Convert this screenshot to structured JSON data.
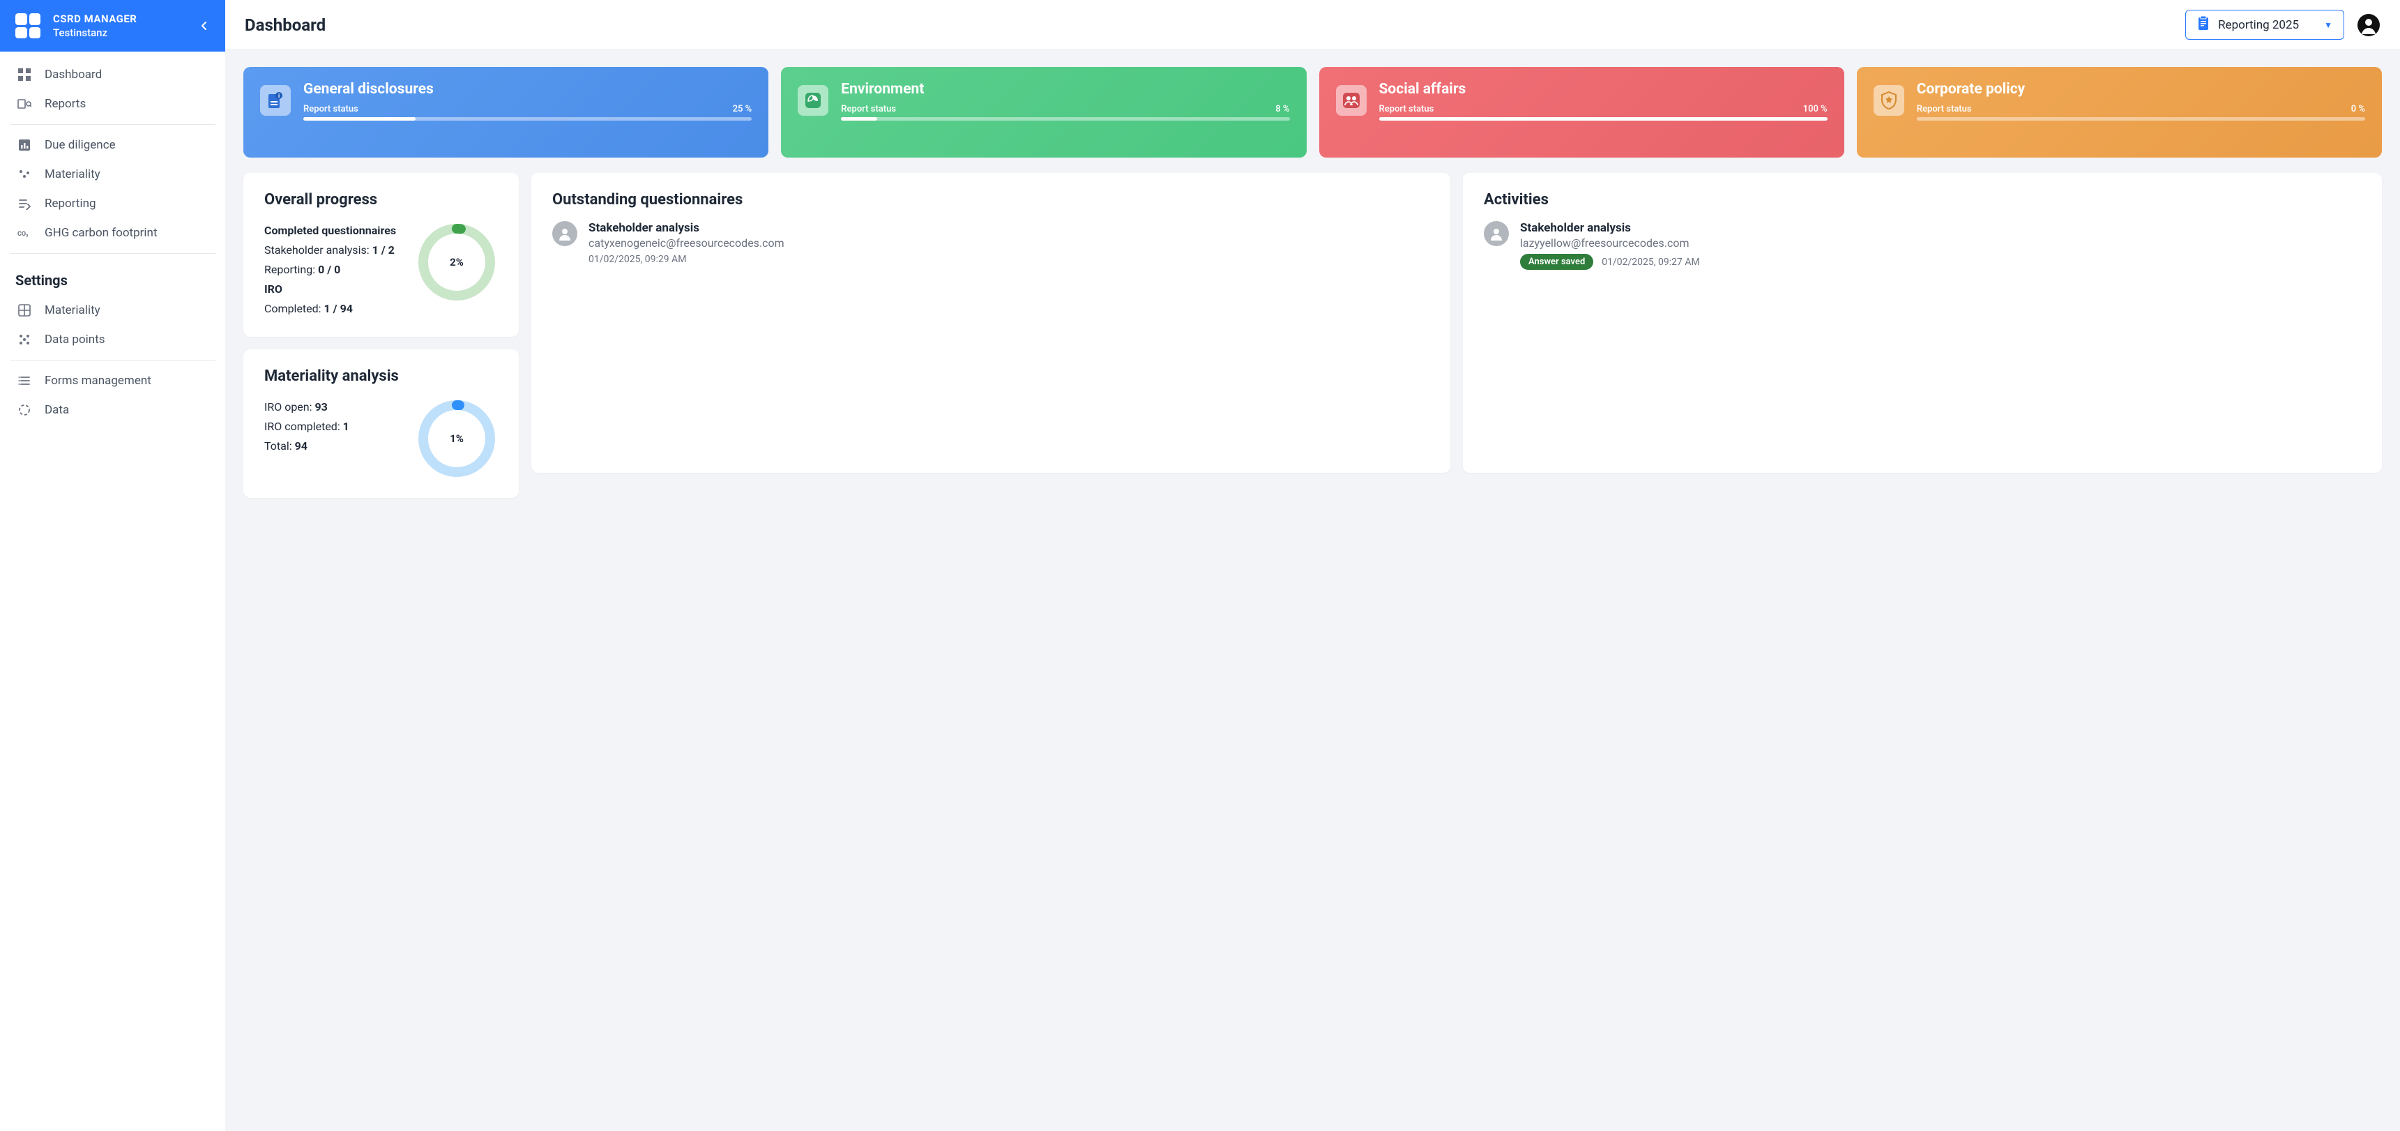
{
  "app": {
    "title": "CSRD MANAGER",
    "subtitle": "Testinstanz"
  },
  "sidebar": {
    "nav1": [
      {
        "label": "Dashboard"
      },
      {
        "label": "Reports"
      }
    ],
    "nav2": [
      {
        "label": "Due diligence"
      },
      {
        "label": "Materiality"
      },
      {
        "label": "Reporting"
      },
      {
        "label": "GHG carbon footprint"
      }
    ],
    "settings_heading": "Settings",
    "nav3": [
      {
        "label": "Materiality"
      },
      {
        "label": "Data points"
      }
    ],
    "nav4": [
      {
        "label": "Forms management"
      },
      {
        "label": "Data"
      }
    ]
  },
  "header": {
    "page_title": "Dashboard",
    "reporting_selector": "Reporting 2025"
  },
  "status_cards": [
    {
      "title": "General disclosures",
      "status_label": "Report status",
      "percent_label": "25 %",
      "percent": 25,
      "color": "blue"
    },
    {
      "title": "Environment",
      "status_label": "Report status",
      "percent_label": "8 %",
      "percent": 8,
      "color": "green"
    },
    {
      "title": "Social affairs",
      "status_label": "Report status",
      "percent_label": "100 %",
      "percent": 100,
      "color": "red"
    },
    {
      "title": "Corporate policy",
      "status_label": "Report status",
      "percent_label": "0 %",
      "percent": 0,
      "color": "orange"
    }
  ],
  "overall_progress": {
    "title": "Overall progress",
    "completed_heading": "Completed questionnaires",
    "stakeholder_label": "Stakeholder analysis:",
    "stakeholder_value": "1 / 2",
    "reporting_label": "Reporting:",
    "reporting_value": "0 / 0",
    "iro_heading": "IRO",
    "iro_completed_label": "Completed:",
    "iro_completed_value": "1 / 94",
    "donut_percent": 2,
    "donut_label": "2%",
    "donut_color": "#3fa34d",
    "donut_track": "#c9e6c8"
  },
  "materiality": {
    "title": "Materiality analysis",
    "open_label": "IRO open:",
    "open_value": "93",
    "completed_label": "IRO completed:",
    "completed_value": "1",
    "total_label": "Total:",
    "total_value": "94",
    "donut_percent": 1,
    "donut_label": "1%",
    "donut_color": "#2e90fa",
    "donut_track": "#bfe0fb"
  },
  "outstanding": {
    "title": "Outstanding questionnaires",
    "items": [
      {
        "title": "Stakeholder analysis",
        "email": "catyxenogeneic@freesourcecodes.com",
        "time": "01/02/2025, 09:29 AM"
      }
    ]
  },
  "activities": {
    "title": "Activities",
    "items": [
      {
        "title": "Stakeholder analysis",
        "email": "lazyyellow@freesourcecodes.com",
        "badge": "Answer saved",
        "time": "01/02/2025, 09:27 AM"
      }
    ]
  },
  "chart_data": [
    {
      "type": "pie",
      "title": "Overall progress",
      "values": [
        2,
        98
      ],
      "labels": [
        "Completed",
        "Remaining"
      ]
    },
    {
      "type": "pie",
      "title": "Materiality analysis",
      "values": [
        1,
        99
      ],
      "labels": [
        "Completed",
        "Open"
      ]
    }
  ]
}
